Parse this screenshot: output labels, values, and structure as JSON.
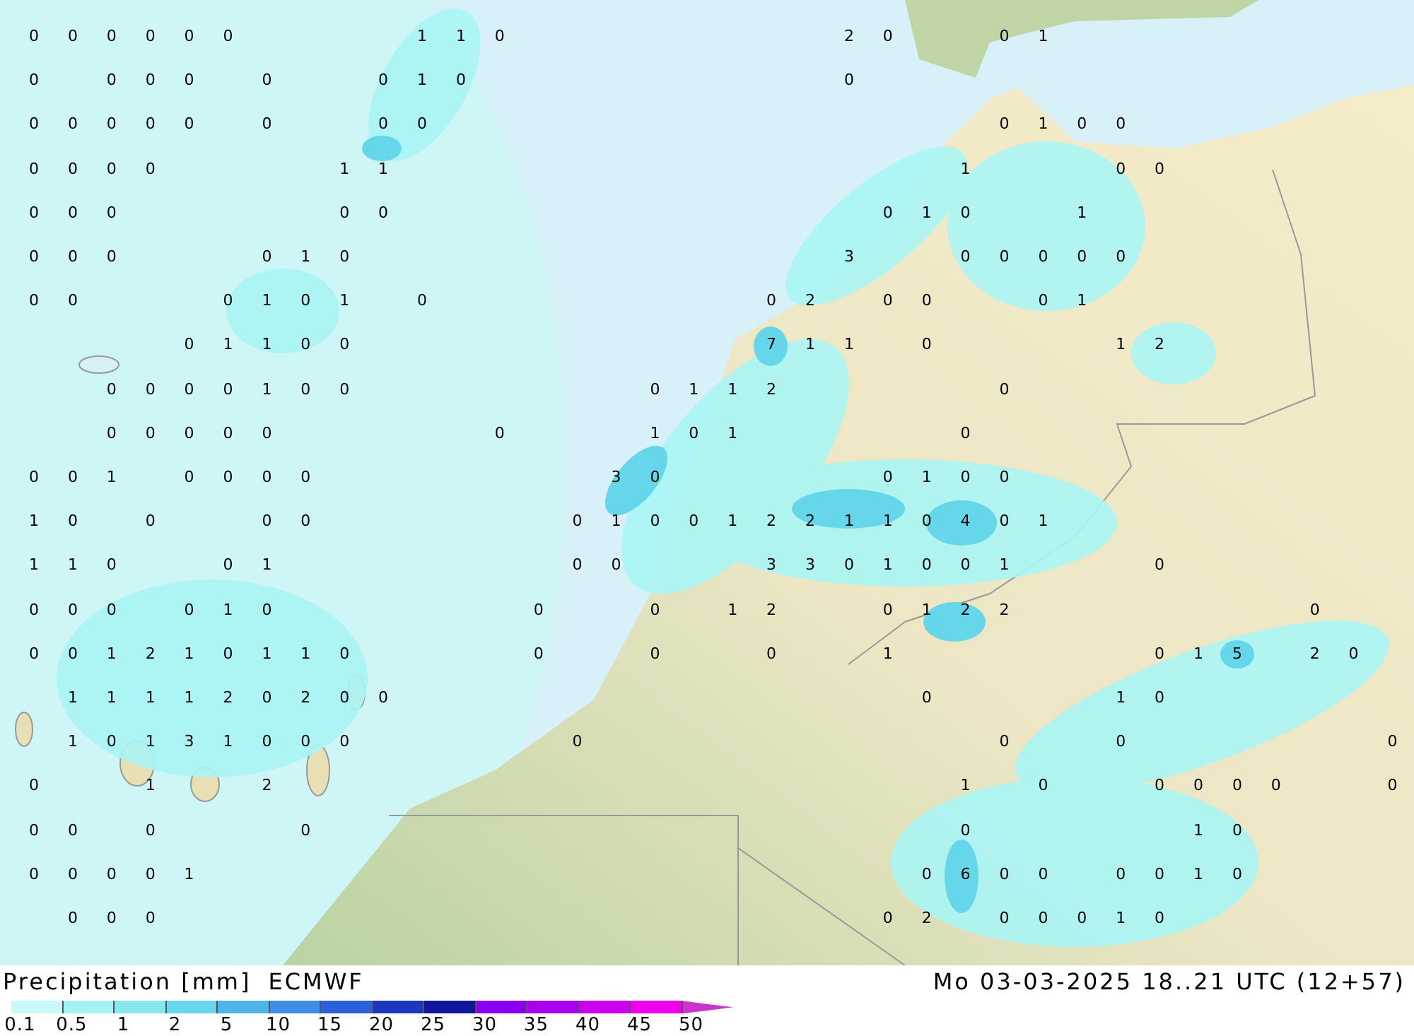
{
  "map": {
    "value_rows": [
      [
        "0",
        "0",
        "0",
        "0",
        "0",
        "0",
        null,
        null,
        null,
        null,
        "1",
        "1",
        "0",
        null,
        null,
        null,
        null,
        null,
        null,
        null,
        null,
        "2",
        "0",
        null,
        null,
        "0",
        "1",
        null,
        null,
        null,
        null,
        null,
        null,
        null,
        null,
        null
      ],
      [
        "0",
        null,
        "0",
        "0",
        "0",
        null,
        "0",
        null,
        null,
        "0",
        "1",
        "0",
        null,
        null,
        null,
        null,
        null,
        null,
        null,
        null,
        null,
        "0",
        null,
        null,
        null,
        null,
        null,
        null,
        null,
        null,
        null,
        null,
        null,
        null,
        null,
        null
      ],
      [
        "0",
        "0",
        "0",
        "0",
        "0",
        null,
        "0",
        null,
        null,
        "0",
        "0",
        null,
        null,
        null,
        null,
        null,
        null,
        null,
        null,
        null,
        null,
        null,
        null,
        null,
        null,
        "0",
        "1",
        "0",
        "0",
        null,
        null,
        null,
        null,
        null,
        null,
        null
      ],
      [
        "0",
        "0",
        "0",
        "0",
        null,
        null,
        null,
        null,
        "1",
        "1",
        null,
        null,
        null,
        null,
        null,
        null,
        null,
        null,
        null,
        null,
        null,
        null,
        null,
        null,
        "1",
        null,
        null,
        null,
        "0",
        "0",
        null,
        null,
        null,
        null,
        null,
        null
      ],
      [
        "0",
        "0",
        "0",
        null,
        null,
        null,
        null,
        null,
        "0",
        "0",
        null,
        null,
        null,
        null,
        null,
        null,
        null,
        null,
        null,
        null,
        null,
        null,
        "0",
        "1",
        "0",
        null,
        null,
        "1",
        null,
        null,
        null,
        null,
        null,
        null,
        null,
        null
      ],
      [
        "0",
        "0",
        "0",
        null,
        null,
        null,
        "0",
        "1",
        "0",
        null,
        null,
        null,
        null,
        null,
        null,
        null,
        null,
        null,
        null,
        null,
        null,
        "3",
        null,
        null,
        "0",
        "0",
        "0",
        "0",
        "0",
        null,
        null,
        null,
        null,
        null,
        null,
        null
      ],
      [
        "0",
        "0",
        null,
        null,
        null,
        "0",
        "1",
        "0",
        "1",
        null,
        "0",
        null,
        null,
        null,
        null,
        null,
        null,
        null,
        null,
        "0",
        "2",
        null,
        "0",
        "0",
        null,
        null,
        "0",
        "1",
        null,
        null,
        null,
        null,
        null,
        null,
        null,
        null
      ],
      [
        null,
        null,
        null,
        null,
        "0",
        "1",
        "1",
        "0",
        "0",
        null,
        null,
        null,
        null,
        null,
        null,
        null,
        null,
        null,
        null,
        "7",
        "1",
        "1",
        null,
        "0",
        null,
        null,
        null,
        null,
        "1",
        "2",
        null,
        null,
        null,
        null,
        null,
        null
      ],
      [
        null,
        null,
        "0",
        "0",
        "0",
        "0",
        "1",
        "0",
        "0",
        null,
        null,
        null,
        null,
        null,
        null,
        null,
        "0",
        "1",
        "1",
        "2",
        null,
        null,
        null,
        null,
        null,
        "0",
        null,
        null,
        null,
        null,
        null,
        null,
        null,
        null,
        null,
        null
      ],
      [
        null,
        null,
        "0",
        "0",
        "0",
        "0",
        "0",
        null,
        null,
        null,
        null,
        null,
        "0",
        null,
        null,
        null,
        "1",
        "0",
        "1",
        null,
        null,
        null,
        null,
        null,
        "0",
        null,
        null,
        null,
        null,
        null,
        null,
        null,
        null,
        null,
        null,
        null
      ],
      [
        "0",
        "0",
        "1",
        null,
        "0",
        "0",
        "0",
        "0",
        null,
        null,
        null,
        null,
        null,
        null,
        null,
        "3",
        "0",
        null,
        null,
        null,
        null,
        null,
        "0",
        "1",
        "0",
        "0",
        null,
        null,
        null,
        null,
        null,
        null,
        null,
        null,
        null,
        null
      ],
      [
        "1",
        "0",
        null,
        "0",
        null,
        null,
        "0",
        "0",
        null,
        null,
        null,
        null,
        null,
        null,
        "0",
        "1",
        "0",
        "0",
        "1",
        "2",
        "2",
        "1",
        "1",
        "0",
        "4",
        "0",
        "1",
        null,
        null,
        null,
        null,
        null,
        null,
        null,
        null,
        null
      ],
      [
        "1",
        "1",
        "0",
        null,
        null,
        "0",
        "1",
        null,
        null,
        null,
        null,
        null,
        null,
        null,
        "0",
        "0",
        null,
        null,
        null,
        "3",
        "3",
        "0",
        "1",
        "0",
        "0",
        "1",
        null,
        null,
        null,
        "0",
        null,
        null,
        null,
        null,
        null,
        null
      ],
      [
        "0",
        "0",
        "0",
        null,
        "0",
        "1",
        "0",
        null,
        null,
        null,
        null,
        null,
        null,
        "0",
        null,
        null,
        "0",
        null,
        "1",
        "2",
        null,
        null,
        "0",
        "1",
        "2",
        "2",
        null,
        null,
        null,
        null,
        null,
        null,
        null,
        "0",
        null,
        null
      ],
      [
        "0",
        "0",
        "1",
        "2",
        "1",
        "0",
        "1",
        "1",
        "0",
        null,
        null,
        null,
        null,
        "0",
        null,
        null,
        "0",
        null,
        null,
        "0",
        null,
        null,
        "1",
        null,
        null,
        null,
        null,
        null,
        null,
        "0",
        "1",
        "5",
        null,
        "2",
        "0",
        null
      ],
      [
        null,
        "1",
        "1",
        "1",
        "1",
        "2",
        "0",
        "2",
        "0",
        "0",
        null,
        null,
        null,
        null,
        null,
        null,
        null,
        null,
        null,
        null,
        null,
        null,
        null,
        "0",
        null,
        null,
        null,
        null,
        "1",
        "0",
        null,
        null,
        null,
        null,
        null,
        null
      ],
      [
        null,
        "1",
        "0",
        "1",
        "3",
        "1",
        "0",
        "0",
        "0",
        null,
        null,
        null,
        null,
        null,
        "0",
        null,
        null,
        null,
        null,
        null,
        null,
        null,
        null,
        null,
        null,
        "0",
        null,
        null,
        "0",
        null,
        null,
        null,
        null,
        null,
        null,
        "0"
      ],
      [
        "0",
        null,
        null,
        "1",
        null,
        null,
        "2",
        null,
        null,
        null,
        null,
        null,
        null,
        null,
        null,
        null,
        null,
        null,
        null,
        null,
        null,
        null,
        null,
        null,
        "1",
        null,
        "0",
        null,
        null,
        "0",
        "0",
        "0",
        "0",
        null,
        null,
        "0"
      ],
      [
        "0",
        "0",
        null,
        "0",
        null,
        null,
        null,
        "0",
        null,
        null,
        null,
        null,
        null,
        null,
        null,
        null,
        null,
        null,
        null,
        null,
        null,
        null,
        null,
        null,
        "0",
        null,
        null,
        null,
        null,
        null,
        "1",
        "0",
        null,
        null,
        null,
        null
      ],
      [
        "0",
        "0",
        "0",
        "0",
        "1",
        null,
        null,
        null,
        null,
        null,
        null,
        null,
        null,
        null,
        null,
        null,
        null,
        null,
        null,
        null,
        null,
        null,
        null,
        "0",
        "6",
        "0",
        "0",
        null,
        "0",
        "0",
        "1",
        "0",
        null,
        null,
        null,
        null
      ],
      [
        null,
        "0",
        "0",
        "0",
        null,
        null,
        null,
        null,
        null,
        null,
        null,
        null,
        null,
        null,
        null,
        null,
        null,
        null,
        null,
        null,
        null,
        null,
        "0",
        "2",
        null,
        "0",
        "0",
        "0",
        "1",
        "0",
        null,
        null,
        null,
        null,
        null,
        null
      ]
    ]
  },
  "legend": {
    "title": "Precipitation [mm]",
    "source": "ECMWF",
    "timestamp": "Mo 03-03-2025 18..21 UTC (12+57)",
    "ticks": [
      "0.1",
      "0.5",
      "1",
      "2",
      "5",
      "10",
      "15",
      "20",
      "25",
      "30",
      "35",
      "40",
      "45",
      "50"
    ],
    "segments": [
      {
        "kind": "band",
        "color": "#c8fafa"
      },
      {
        "kind": "band",
        "color": "#a4f2f2"
      },
      {
        "kind": "band",
        "color": "#86e8ec"
      },
      {
        "kind": "band",
        "color": "#66d6ea"
      },
      {
        "kind": "band",
        "color": "#4fb4ea"
      },
      {
        "kind": "band",
        "color": "#3f8ee8"
      },
      {
        "kind": "band",
        "color": "#2c5fdc"
      },
      {
        "kind": "band",
        "color": "#1c36c0"
      },
      {
        "kind": "band",
        "color": "#10169c"
      },
      {
        "kind": "band",
        "color": "#8a00f0"
      },
      {
        "kind": "band",
        "color": "#aa00ee"
      },
      {
        "kind": "band",
        "color": "#cc00ee"
      },
      {
        "kind": "band",
        "color": "#ee00ee"
      },
      {
        "kind": "arrow",
        "color": "#cc33cc"
      }
    ]
  }
}
